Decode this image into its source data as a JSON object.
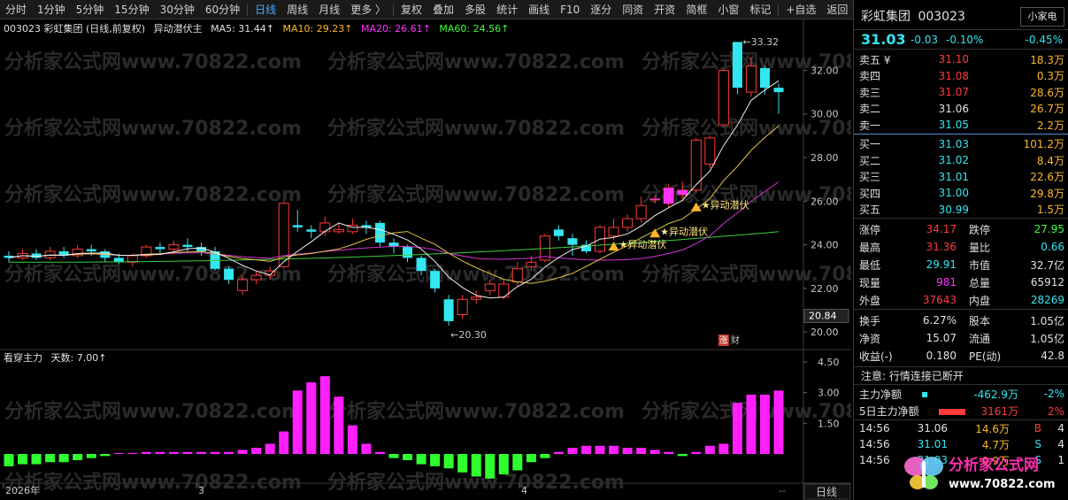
{
  "toolbar": {
    "items": [
      "分时",
      "1分钟",
      "5分钟",
      "15分钟",
      "30分钟",
      "60分钟",
      "日线",
      "周线",
      "月线",
      "更多 〉",
      "复权",
      "叠加",
      "多股",
      "统计",
      "画线",
      "F10",
      "逐分",
      "同资",
      "开资",
      "简框",
      "小窗",
      "标记",
      "+自选",
      "返回"
    ],
    "active": "日线"
  },
  "chart": {
    "info_code_name": "003023  彩虹集团 (日线,前复权)",
    "indicator_name": "异动潜伏主",
    "ma5": "MA5: 31.44↑",
    "ma10": "MA10: 29.23↑",
    "ma20": "MA20: 26.61↑",
    "ma60": "MA60: 24.56↑",
    "price_ticks": [
      "32.00",
      "30.00",
      "28.00",
      "26.00",
      "24.00",
      "22.00",
      "20.00"
    ],
    "current_price_label": "20.84",
    "high_label": "33.32",
    "low_label": "20.30",
    "signal_text": "★异动潜伏",
    "badge_zhang": "涨",
    "badge_cai": "财",
    "sub_title": "看穿主力",
    "sub_days": "天数: 7.00↑",
    "sub_ticks": [
      "4.50",
      "3.00",
      "1.50"
    ],
    "date_labels": [
      "2026年",
      "3",
      "4"
    ],
    "period_button": "日线",
    "scroll_label": "--",
    "watermark": "分析家公式网www.70822.com"
  },
  "quote": {
    "name": "彩虹集团",
    "code": "003023",
    "price": "31.03",
    "change": "-0.03",
    "change_pct": "-0.10%",
    "sector": "小家电",
    "sector_pct": "-0.45%",
    "asks": [
      {
        "label": "卖五 ¥",
        "price": "31.10",
        "vol": "18.3万"
      },
      {
        "label": "卖四",
        "price": "31.08",
        "vol": "0.3万"
      },
      {
        "label": "卖三",
        "price": "31.07",
        "vol": "28.6万"
      },
      {
        "label": "卖二",
        "price": "31.06",
        "vol": "26.7万"
      },
      {
        "label": "卖一",
        "price": "31.05",
        "vol": "2.2万"
      }
    ],
    "bids": [
      {
        "label": "买一",
        "price": "31.03",
        "vol": "101.2万"
      },
      {
        "label": "买二",
        "price": "31.02",
        "vol": "8.4万"
      },
      {
        "label": "买三",
        "price": "31.01",
        "vol": "22.6万"
      },
      {
        "label": "买四",
        "price": "31.00",
        "vol": "29.8万"
      },
      {
        "label": "买五",
        "price": "30.99",
        "vol": "1.5万"
      }
    ],
    "stats": [
      {
        "k1": "涨停",
        "v1": "34.17",
        "k2": "跌停",
        "v2": "27.95"
      },
      {
        "k1": "最高",
        "v1": "31.36",
        "k2": "量比",
        "v2": "0.66"
      },
      {
        "k1": "最低",
        "v1": "29.91",
        "k2": "市值",
        "v2": "32.7亿"
      },
      {
        "k1": "现量",
        "v1": "981",
        "k2": "总量",
        "v2": "65912"
      },
      {
        "k1": "外盘",
        "v1": "37643",
        "k2": "内盘",
        "v2": "28269"
      }
    ],
    "stats2": [
      {
        "k1": "换手",
        "v1": "6.27%",
        "k2": "股本",
        "v2": "1.05亿"
      },
      {
        "k1": "净资",
        "v1": "15.07",
        "k2": "流通",
        "v2": "1.05亿"
      },
      {
        "k1": "收益(-)",
        "v1": "0.180",
        "k2": "PE(动)",
        "v2": "42.8"
      }
    ],
    "notice": "注意: 行情连接已断开",
    "main_net_label": "主力净额",
    "main_net_val": "-462.9万",
    "main_net_pct": "-2%",
    "main5_label": "5日主力净额",
    "main5_val": "3161万",
    "main5_pct": "2%",
    "ticks": [
      {
        "t": "14:56",
        "p": "31.06",
        "v": "14.6万",
        "s": "B",
        "n": "4"
      },
      {
        "t": "14:56",
        "p": "31.01",
        "v": "4.7万",
        "s": "S",
        "n": "4"
      },
      {
        "t": "14:56",
        "p": "31.03",
        "v": "0.9万",
        "s": "S",
        "n": "1"
      }
    ],
    "logo_text": "分析家公式网",
    "logo_url": "www.70822.com"
  },
  "colors": {
    "up": "#ff3b3b",
    "down": "#33e6f0",
    "accent": "#4aa8ff"
  }
}
